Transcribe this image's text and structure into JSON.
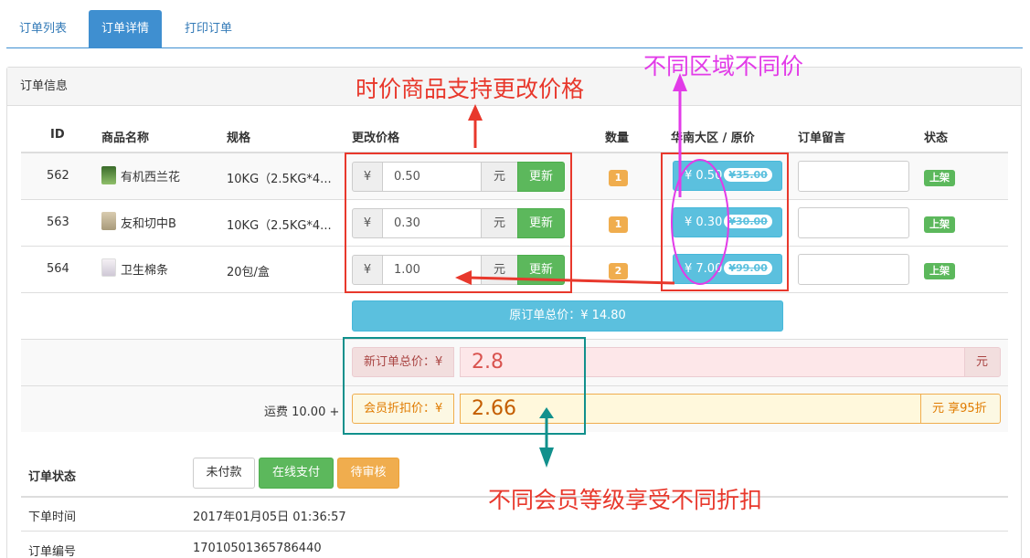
{
  "tabs": [
    "订单列表",
    "订单详情",
    "打印订单"
  ],
  "panel_title": "订单信息",
  "columns": [
    "ID",
    "商品名称",
    "规格",
    "更改价格",
    "数量",
    "华南大区 / 原价",
    "订单留言",
    "状态"
  ],
  "items": [
    {
      "id": "562",
      "name": "有机西兰花",
      "spec": "10KG（2.5KG*4...",
      "currency": "¥",
      "price": "0.50",
      "unit": "元",
      "update": "更新",
      "qty": "1",
      "region_price": "¥ 0.50",
      "orig_price": "¥35.00",
      "status": "上架"
    },
    {
      "id": "563",
      "name": "友和切中B",
      "spec": "10KG（2.5KG*4...",
      "currency": "¥",
      "price": "0.30",
      "unit": "元",
      "update": "更新",
      "qty": "1",
      "region_price": "¥ 0.30",
      "orig_price": "¥30.00",
      "status": "上架"
    },
    {
      "id": "564",
      "name": "卫生棉条",
      "spec": "20包/盒",
      "currency": "¥",
      "price": "1.00",
      "unit": "元",
      "update": "更新",
      "qty": "2",
      "region_price": "¥ 7.00",
      "orig_price": "¥99.00",
      "status": "上架"
    }
  ],
  "original_total": "原订单总价：¥ 14.80",
  "new_total": {
    "label": "新订单总价：¥",
    "value": "2.8",
    "unit": "元"
  },
  "shipping": "运费 10.00 +",
  "member_price": {
    "label": "会员折扣价：¥",
    "value": "2.66",
    "suffix": "元 享95折"
  },
  "order_status": {
    "label": "订单状态",
    "buttons": [
      "未付款",
      "在线支付",
      "待审核"
    ]
  },
  "order_time": {
    "label": "下单时间",
    "value": "2017年01月05日 01:36:57"
  },
  "order_no": {
    "label": "订单编号",
    "value": "17010501365786440"
  },
  "annotations": {
    "price_change": "时价商品支持更改价格",
    "region": "不同区域不同价",
    "member": "不同会员等级享受不同折扣"
  },
  "colors": {
    "primary": "#3f8fd0",
    "success": "#5cb85c",
    "info": "#5bc0de",
    "warning": "#f0ad4e",
    "annot_red": "#e8382c",
    "annot_magenta": "#e23be8",
    "annot_teal": "#11908c"
  }
}
